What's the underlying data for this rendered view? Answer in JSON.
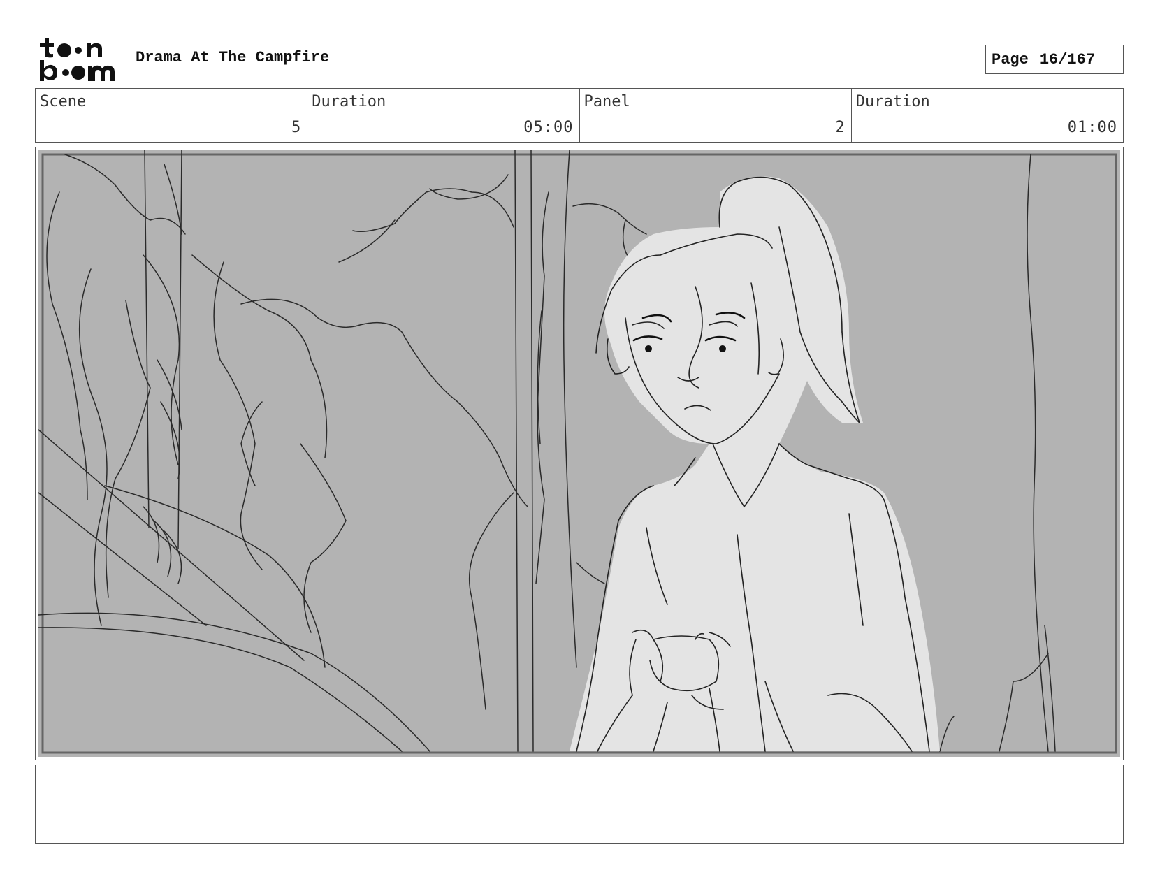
{
  "header": {
    "logo_text": "toon boom",
    "project_title": "Drama At The Campfire",
    "page_label": "Page",
    "page_number": "16/167"
  },
  "info": {
    "scene_label": "Scene",
    "scene_value": "5",
    "scene_duration_label": "Duration",
    "scene_duration_value": "05:00",
    "panel_label": "Panel",
    "panel_value": "2",
    "panel_duration_label": "Duration",
    "panel_duration_value": "01:00"
  },
  "notes": {
    "text": ""
  },
  "colors": {
    "background_fill": "#b3b3b3",
    "character_fill": "#e4e4e4",
    "line": "#222222"
  }
}
